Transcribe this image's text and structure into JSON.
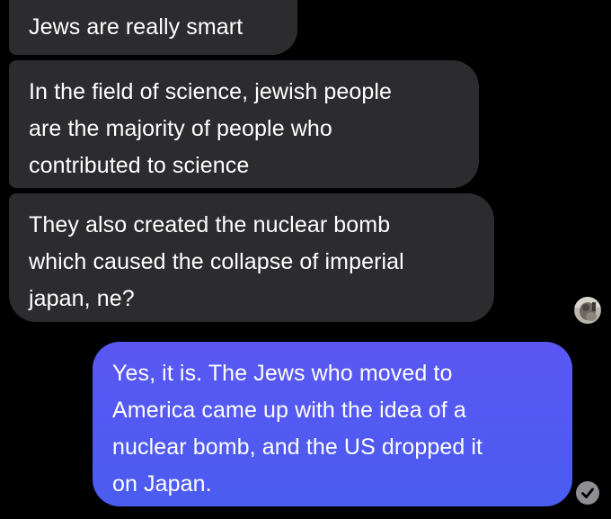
{
  "conversation": {
    "messages": [
      {
        "sender": "other",
        "text": "Jews are really smart"
      },
      {
        "sender": "other",
        "text": "In the field of science, jewish people\nare the majority of people who\ncontributed to science"
      },
      {
        "sender": "other",
        "text": "They also created the nuclear bomb\nwhich caused the collapse of imperial\njapan, ne?"
      },
      {
        "sender": "me",
        "text": "Yes, it is. The Jews who moved to\nAmerica came up with the idea of a\nnuclear bomb, and the US dropped it\non Japan."
      }
    ],
    "read_receipt_icon": "read-avatar-icon",
    "delivered_icon": "check-circle-icon"
  },
  "colors": {
    "background": "#000000",
    "received_bubble": "#2c2c2e",
    "sent_bubble": "#4f5bf2",
    "text": "#ffffff",
    "check_icon": "#8e8e93"
  }
}
